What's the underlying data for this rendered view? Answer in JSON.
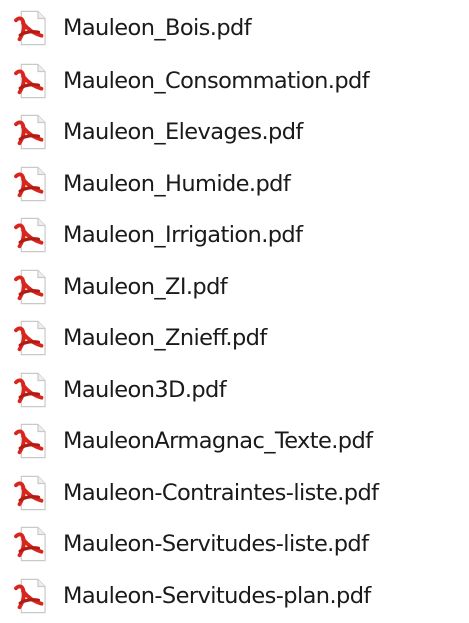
{
  "files": [
    {
      "name": "Mauleon_Bois.pdf",
      "icon": "pdf-file-icon"
    },
    {
      "name": "Mauleon_Consommation.pdf",
      "icon": "pdf-file-icon"
    },
    {
      "name": "Mauleon_Elevages.pdf",
      "icon": "pdf-file-icon"
    },
    {
      "name": "Mauleon_Humide.pdf",
      "icon": "pdf-file-icon"
    },
    {
      "name": "Mauleon_Irrigation.pdf",
      "icon": "pdf-file-icon"
    },
    {
      "name": "Mauleon_ZI.pdf",
      "icon": "pdf-file-icon"
    },
    {
      "name": "Mauleon_Znieff.pdf",
      "icon": "pdf-file-icon"
    },
    {
      "name": "Mauleon3D.pdf",
      "icon": "pdf-file-icon"
    },
    {
      "name": "MauleonArmagnac_Texte.pdf",
      "icon": "pdf-file-icon"
    },
    {
      "name": "Mauleon-Contraintes-liste.pdf",
      "icon": "pdf-file-icon"
    },
    {
      "name": "Mauleon-Servitudes-liste.pdf",
      "icon": "pdf-file-icon"
    },
    {
      "name": "Mauleon-Servitudes-plan.pdf",
      "icon": "pdf-file-icon"
    }
  ],
  "colors": {
    "icon_red": "#d9251d",
    "icon_red_dark": "#b01b14",
    "icon_paper": "#ffffff",
    "icon_border": "#c9c9c9",
    "text": "#1a1a1a",
    "background": "#ffffff"
  }
}
